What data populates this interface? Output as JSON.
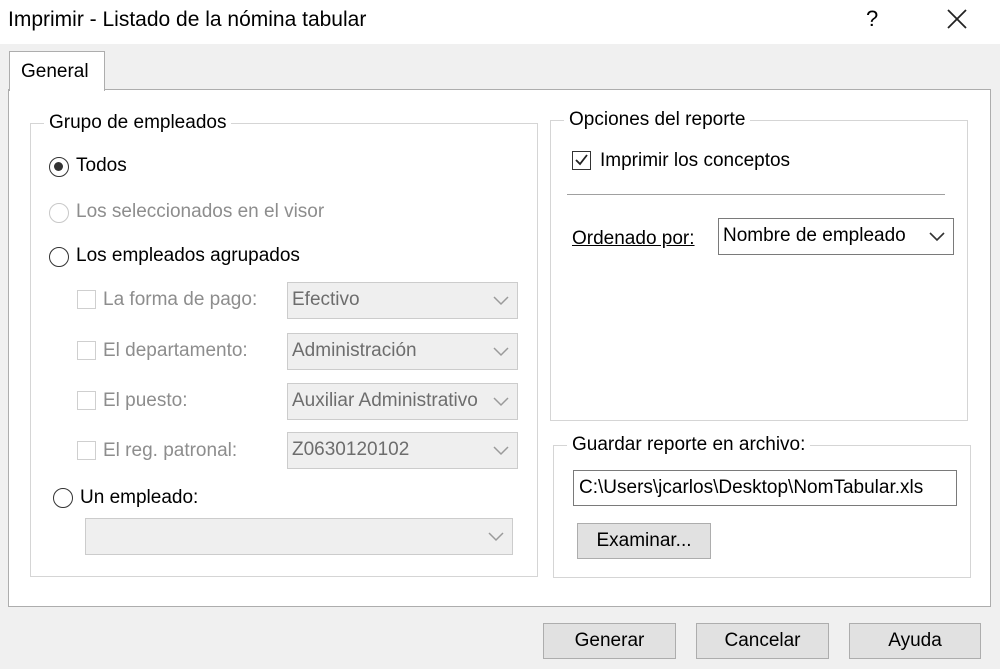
{
  "window": {
    "title": "Imprimir - Listado de la nómina tabular",
    "help_glyph": "?"
  },
  "tabs": [
    {
      "label": "General",
      "selected": true
    }
  ],
  "grupo_empleados": {
    "legend": "Grupo de empleados",
    "options": [
      {
        "label": "Todos",
        "checked": true,
        "enabled": true
      },
      {
        "label": "Los seleccionados en el visor",
        "checked": false,
        "enabled": false
      },
      {
        "label": "Los empleados agrupados",
        "checked": false,
        "enabled": true
      },
      {
        "label": "Un empleado:",
        "checked": false,
        "enabled": true
      }
    ],
    "filters": [
      {
        "label": "La forma de pago:",
        "value": "Efectivo",
        "checked": false,
        "enabled": false
      },
      {
        "label": "El departamento:",
        "value": "Administración",
        "checked": false,
        "enabled": false
      },
      {
        "label": "El puesto:",
        "value": "Auxiliar Administrativo",
        "checked": false,
        "enabled": false
      },
      {
        "label": "El reg. patronal:",
        "value": "Z0630120102",
        "checked": false,
        "enabled": false
      }
    ],
    "empleado_value": ""
  },
  "opciones_reporte": {
    "legend": "Opciones del reporte",
    "imprimir_conceptos": {
      "label": "Imprimir los conceptos",
      "checked": true
    },
    "ordenado_por": {
      "label": "Ordenado por:",
      "value": "Nombre de empleado"
    }
  },
  "guardar": {
    "legend": "Guardar reporte en archivo:",
    "path": "C:\\Users\\jcarlos\\Desktop\\NomTabular.xls",
    "examinar_label": "Examinar..."
  },
  "footer": {
    "generar_label": "Generar",
    "cancelar_label": "Cancelar",
    "ayuda_label": "Ayuda"
  }
}
